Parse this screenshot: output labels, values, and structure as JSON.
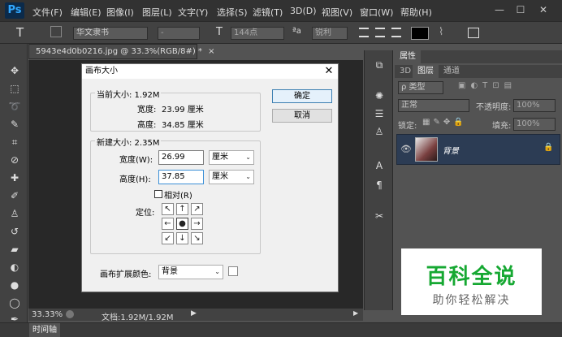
{
  "app": {
    "logo": "Ps"
  },
  "menu": [
    "文件(F)",
    "编辑(E)",
    "图像(I)",
    "图层(L)",
    "文字(Y)",
    "选择(S)",
    "滤镜(T)",
    "3D(D)",
    "视图(V)",
    "窗口(W)",
    "帮助(H)"
  ],
  "window_controls": {
    "minimize": "—",
    "maximize": "☐",
    "close": "✕"
  },
  "options": {
    "tool_icon": "T",
    "font_family": "华文隶书",
    "font_style": "-",
    "font_size": "144点",
    "aa_label": "ªa",
    "aa_mode": "锐利"
  },
  "document": {
    "tab_title": "5943e4d0b0216.jpg @ 33.3%(RGB/8#) *",
    "close": "×"
  },
  "status": {
    "zoom": "33.33%",
    "doc_info": "文档:1.92M/1.92M"
  },
  "timeline": {
    "label": "时间轴"
  },
  "right_panel": {
    "tab_properties": "属性",
    "tabs": [
      "3D",
      "图层",
      "通道"
    ],
    "kind_filter": "ρ 类型",
    "blend_mode": "正常",
    "opacity_label": "不透明度:",
    "opacity_value": "100%",
    "lock_label": "锁定:",
    "fill_label": "填充:",
    "fill_value": "100%",
    "layer_name": "背景"
  },
  "dialog": {
    "title": "画布大小",
    "close": "✕",
    "current_size": {
      "legend": "当前大小: 1.92M",
      "width_label": "宽度:",
      "width_value": "23.99 厘米",
      "height_label": "高度:",
      "height_value": "34.85 厘米"
    },
    "new_size": {
      "legend": "新建大小: 2.35M",
      "width_label": "宽度(W):",
      "width_value": "26.99",
      "width_unit": "厘米",
      "height_label": "高度(H):",
      "height_value": "37.85",
      "height_unit": "厘米",
      "relative_label": "相对(R)",
      "anchor_label": "定位:"
    },
    "extension_color_label": "画布扩展颜色:",
    "extension_color_value": "背景",
    "ok": "确定",
    "cancel": "取消"
  },
  "watermark": {
    "title": "百科全说",
    "subtitle": "助你轻松解决"
  }
}
